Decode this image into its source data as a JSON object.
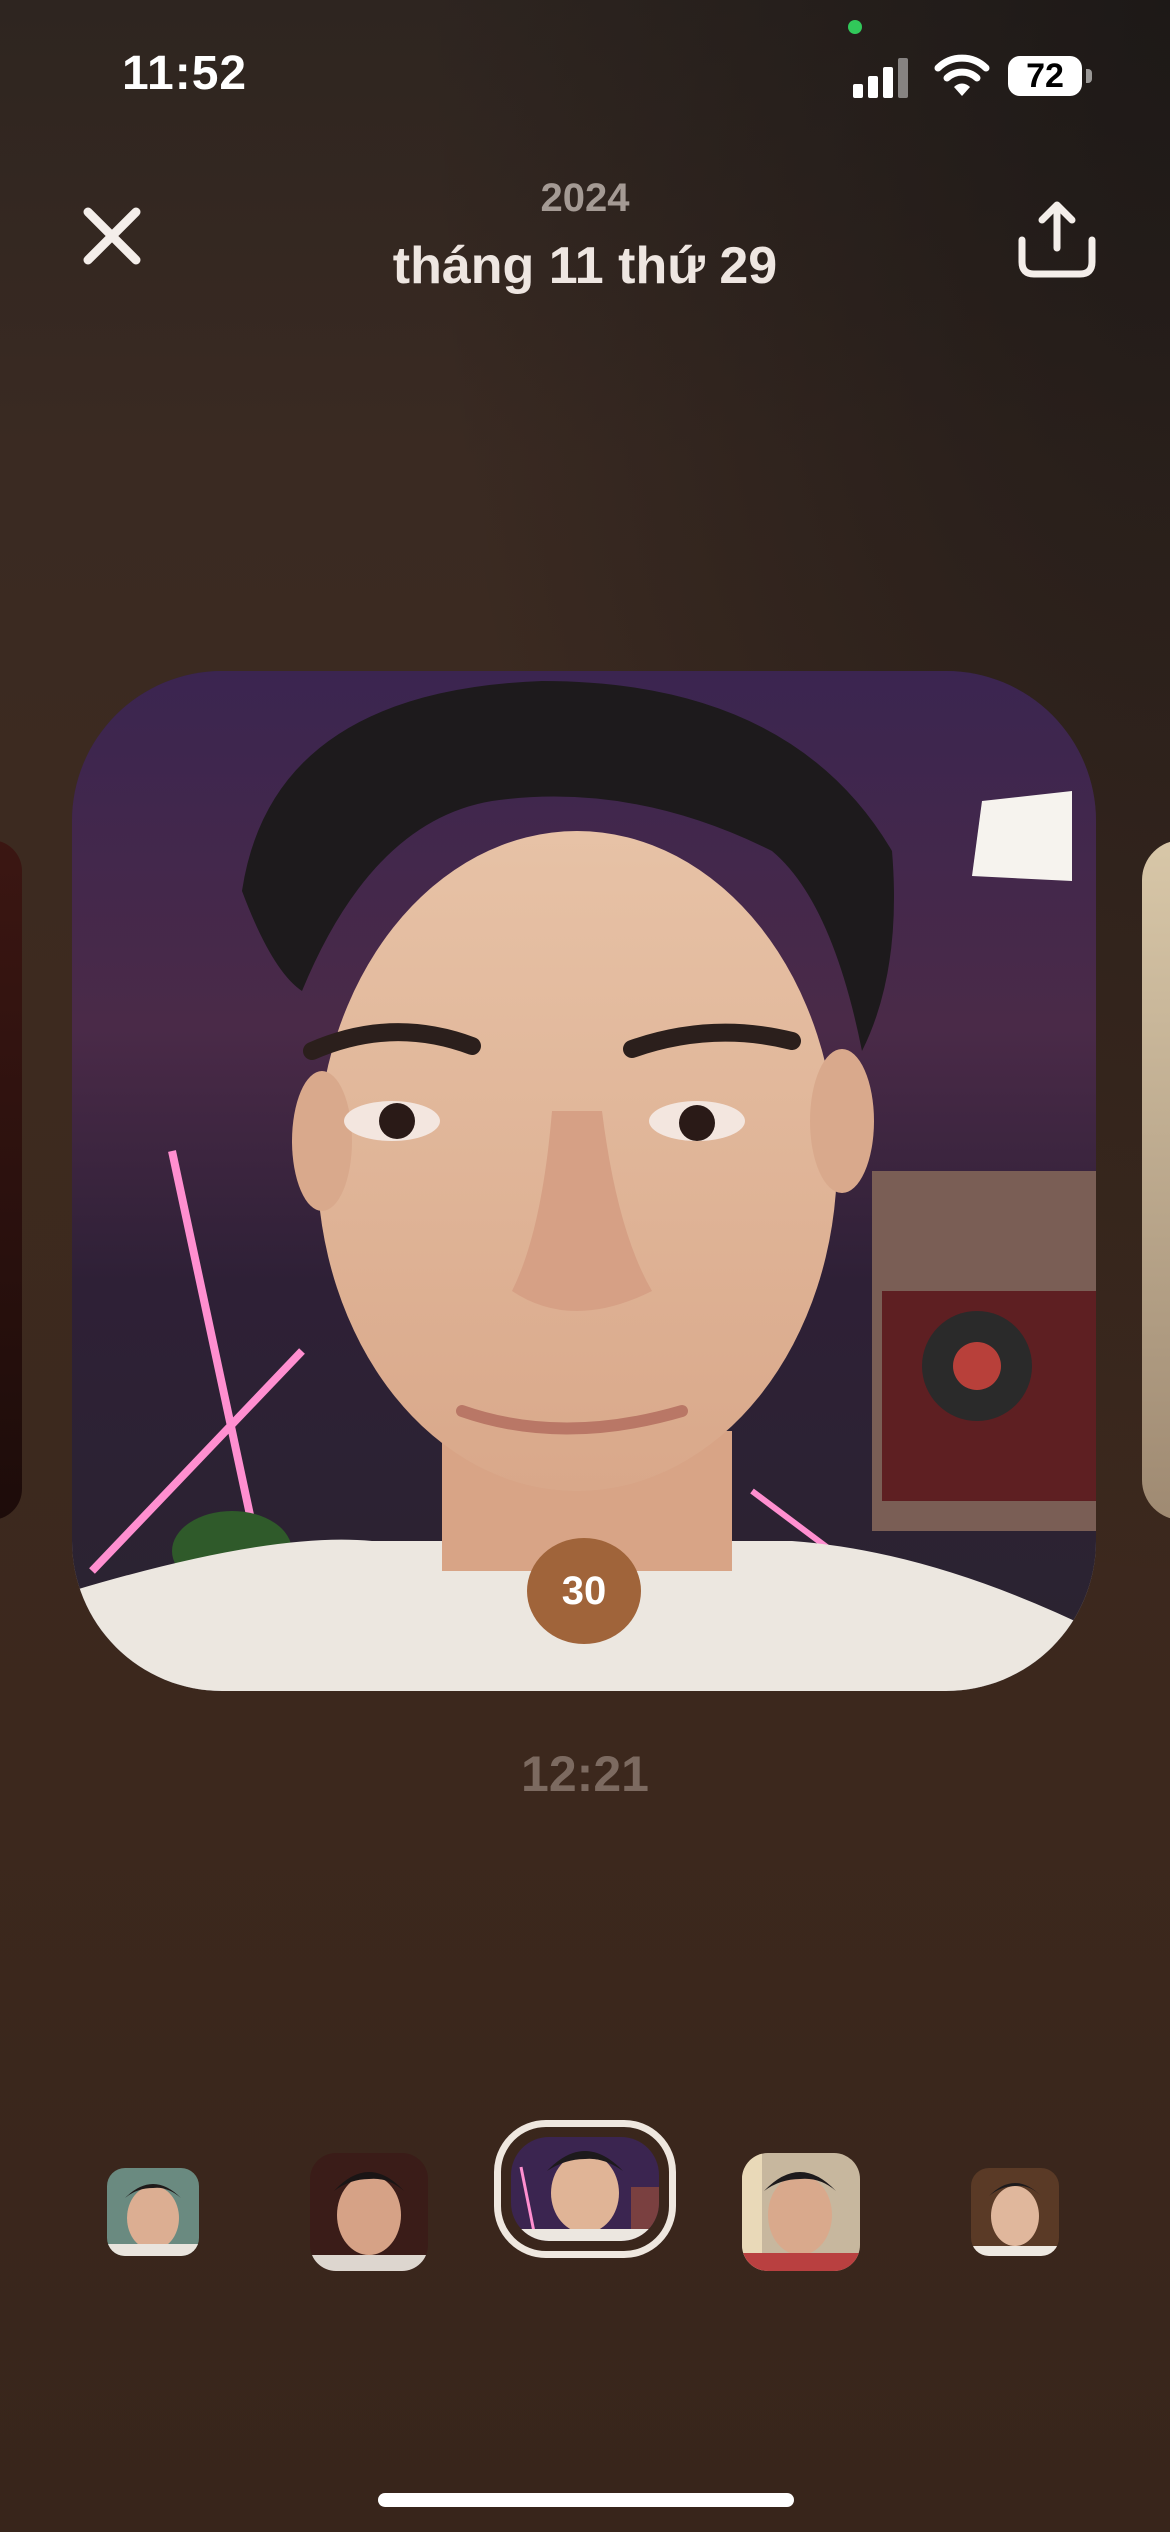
{
  "status_bar": {
    "time": "11:52",
    "battery": "72"
  },
  "header": {
    "year": "2024",
    "date": "tháng 11 thứ 29"
  },
  "photo": {
    "day_badge": "30",
    "time": "12:21"
  },
  "colors": {
    "background": "#3a2820",
    "badge": "#a0643a",
    "selected_ring": "#efe7df",
    "mic_indicator": "#31c85a"
  },
  "thumbnails": [
    {
      "name": "thumb-1"
    },
    {
      "name": "thumb-2"
    },
    {
      "name": "thumb-3",
      "selected": true
    },
    {
      "name": "thumb-4"
    },
    {
      "name": "thumb-5"
    }
  ]
}
